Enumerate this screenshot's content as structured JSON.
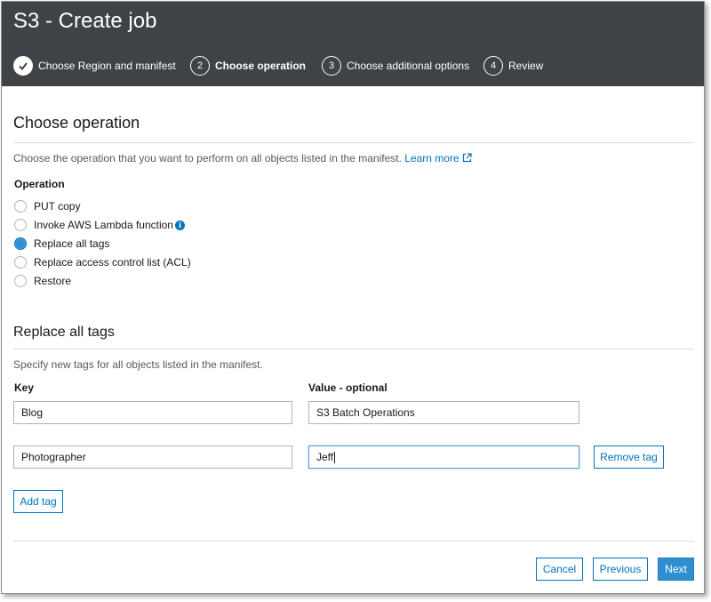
{
  "header": {
    "title": "S3 - Create job",
    "steps": [
      {
        "number": "",
        "label": "Choose Region and manifest",
        "state": "done"
      },
      {
        "number": "2",
        "label": "Choose operation",
        "state": "active"
      },
      {
        "number": "3",
        "label": "Choose additional options",
        "state": "pending"
      },
      {
        "number": "4",
        "label": "Review",
        "state": "pending"
      }
    ]
  },
  "operation_section": {
    "title": "Choose operation",
    "description": "Choose the operation that you want to perform on all objects listed in the manifest.",
    "learn_more": "Learn more",
    "operation_label": "Operation",
    "options": [
      {
        "label": "PUT copy",
        "selected": false
      },
      {
        "label": "Invoke AWS Lambda function",
        "selected": false,
        "info_icon": "i"
      },
      {
        "label": "Replace all tags",
        "selected": true
      },
      {
        "label": "Replace access control list (ACL)",
        "selected": false
      },
      {
        "label": "Restore",
        "selected": false
      }
    ]
  },
  "tags_section": {
    "title": "Replace all tags",
    "description": "Specify new tags for all objects listed in the manifest.",
    "key_label": "Key",
    "value_label": "Value - optional",
    "rows": [
      {
        "key": "Blog",
        "value": "S3 Batch Operations"
      },
      {
        "key": "Photographer",
        "value": "Jeff"
      }
    ],
    "remove_tag_label": "Remove tag",
    "add_tag_label": "Add tag"
  },
  "footer": {
    "cancel_label": "Cancel",
    "previous_label": "Previous",
    "next_label": "Next"
  },
  "colors": {
    "header_bg": "#3f4246",
    "accent": "#0073bb",
    "primary_button": "#2f8fd1"
  }
}
